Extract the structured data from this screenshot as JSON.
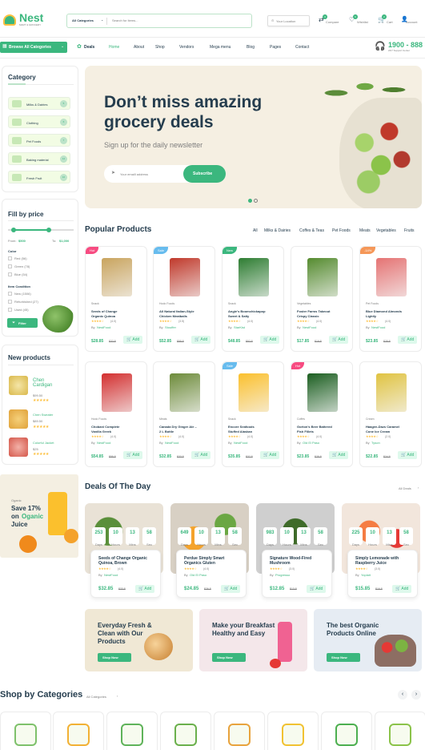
{
  "brand": {
    "name": "Nest",
    "tagline": "MART & GROCERY"
  },
  "search": {
    "category": "All Categories",
    "placeholder": "Search for items..."
  },
  "location": "Your Location",
  "header_actions": [
    {
      "label": "Compare",
      "count": "3"
    },
    {
      "label": "Wishlist",
      "count": "6"
    },
    {
      "label": "Cart",
      "count": "2"
    },
    {
      "label": "Account",
      "count": ""
    }
  ],
  "browse": "Browse All Categories",
  "nav": [
    "Deals",
    "Home",
    "About",
    "Shop",
    "Vendors",
    "Mega menu",
    "Blog",
    "Pages",
    "Contact"
  ],
  "support": {
    "phone": "1900 - 888",
    "sub": "24/7 Support Center"
  },
  "sidebar": {
    "category_title": "Category",
    "categories": [
      {
        "label": "Milks & Dairies",
        "count": "5"
      },
      {
        "label": "Clothing",
        "count": "6"
      },
      {
        "label": "Pet Foods",
        "count": "7"
      },
      {
        "label": "Baking material",
        "count": "12"
      },
      {
        "label": "Fresh Fruit",
        "count": "16"
      }
    ],
    "price_title": "Fill by price",
    "price_from_label": "From:",
    "price_from": "$500",
    "price_to_label": "To:",
    "price_to": "$1,000",
    "color_title": "Color",
    "colors": [
      "Red (56)",
      "Green (78)",
      "Blue (54)"
    ],
    "condition_title": "Item Condition",
    "conditions": [
      "New (1506)",
      "Refurbished (27)",
      "Used (45)"
    ],
    "filter": "Filter",
    "new_title": "New products",
    "new_products": [
      {
        "name": "Chen Cardigan",
        "price": "$99.50"
      },
      {
        "name": "Chen Sweater",
        "price": "$89.50"
      },
      {
        "name": "Colorful Jacket",
        "price": "$25"
      }
    ],
    "promo": {
      "small": "Oganic",
      "line1": "Save 17%",
      "line2": "on",
      "line2b": "Oganic",
      "line3": "Juice"
    }
  },
  "hero": {
    "title1": "Don’t miss amazing",
    "title2": "grocery deals",
    "subtitle": "Sign up for the daily newsletter",
    "email_placeholder": "Your emaill address",
    "button": "Subscribe"
  },
  "popular": {
    "title": "Popular Products",
    "tabs": [
      "All",
      "Milks & Dairies",
      "Coffes & Teas",
      "Pet Foods",
      "Meats",
      "Vegetables",
      "Fruits"
    ],
    "products": [
      {
        "badge": "Hot",
        "cat": "Snack",
        "name1": "Seeds of Change",
        "name2": "Organic Quinoa",
        "rating": "(4.0)",
        "by": "By",
        "vendor": "NestFood",
        "price": "$28.85",
        "old": "$32.8",
        "add": "Add"
      },
      {
        "badge": "Sale",
        "cat": "Hodo Foods",
        "name1": "All Natural Italian-Style",
        "name2": "Chicken Meatballs",
        "rating": "(3.5)",
        "by": "By",
        "vendor": "Stouffer",
        "price": "$52.85",
        "old": "$55.8",
        "add": "Add"
      },
      {
        "badge": "New",
        "cat": "Snack",
        "name1": "Angie’s Boomchickapop",
        "name2": "Sweet & Salty",
        "rating": "(4.0)",
        "by": "By",
        "vendor": "StarKist",
        "price": "$48.85",
        "old": "$52.8",
        "add": "Add"
      },
      {
        "badge": "",
        "cat": "Vegetables",
        "name1": "Foster Farms Takeout",
        "name2": "Crispy Classic",
        "rating": "(4.0)",
        "by": "By",
        "vendor": "NestFood",
        "price": "$17.85",
        "old": "$19.8",
        "add": "Add"
      },
      {
        "badge": "-14%",
        "cat": "Pet Foods",
        "name1": "Blue Diamond Almonds",
        "name2": "Lightly",
        "rating": "(4.0)",
        "by": "By",
        "vendor": "NestFood",
        "price": "$23.85",
        "old": "$25.8",
        "add": "Add"
      },
      {
        "badge": "",
        "cat": "Hodo Foods",
        "name1": "Chobani Complete",
        "name2": "Vanilla Greek",
        "rating": "(4.0)",
        "by": "By",
        "vendor": "NestFood",
        "price": "$54.85",
        "old": "$55.8",
        "add": "Add"
      },
      {
        "badge": "",
        "cat": "Meats",
        "name1": "Canada Dry Ginger Ale –",
        "name2": "2 L Bottle",
        "rating": "(4.0)",
        "by": "By",
        "vendor": "NestFood",
        "price": "$32.85",
        "old": "$33.8",
        "add": "Add"
      },
      {
        "badge": "Sale",
        "cat": "Snack",
        "name1": "Encore Seafoods",
        "name2": "Stuffed Alaskan",
        "rating": "(4.0)",
        "by": "By",
        "vendor": "NestFood",
        "price": "$35.85",
        "old": "$37.8",
        "add": "Add"
      },
      {
        "badge": "Hot",
        "cat": "Coffes",
        "name1": "Gorton’s Beer Battered",
        "name2": "Fish Fillets",
        "rating": "(4.0)",
        "by": "By",
        "vendor": "Old El Paso",
        "price": "$23.85",
        "old": "$25.8",
        "add": "Add"
      },
      {
        "badge": "",
        "cat": "Cream",
        "name1": "Haagen-Dazs Caramel",
        "name2": "Cone Ice Cream",
        "rating": "(2.0)",
        "by": "By",
        "vendor": "Tyson",
        "price": "$22.85",
        "old": "$24.8",
        "add": "Add"
      }
    ]
  },
  "deals": {
    "title": "Deals Of The Day",
    "all": "All Deals",
    "items": [
      {
        "cd": [
          "253",
          "10",
          "13",
          "58"
        ],
        "name1": "Seeds of Change Organic",
        "name2": "Quinoa, Brown",
        "rating": "(4.0)",
        "by": "By",
        "vendor": "NestFood",
        "price": "$32.85",
        "old": "$33.8",
        "add": "Add"
      },
      {
        "cd": [
          "649",
          "10",
          "13",
          "58"
        ],
        "name1": "Perdue Simply Smart",
        "name2": "Organics Gluten",
        "rating": "(4.0)",
        "by": "By",
        "vendor": "Old El Paso",
        "price": "$24.85",
        "old": "$26.8",
        "add": "Add"
      },
      {
        "cd": [
          "983",
          "10",
          "13",
          "58"
        ],
        "name1": "Signature Wood-Fired",
        "name2": "Mushroom",
        "rating": "(3.0)",
        "by": "By",
        "vendor": "Progresso",
        "price": "$12.85",
        "old": "$13.8",
        "add": "Add"
      },
      {
        "cd": [
          "225",
          "10",
          "13",
          "58"
        ],
        "name1": "Simply Lemonade with",
        "name2": "Raspberry Juice",
        "rating": "(3.0)",
        "by": "By",
        "vendor": "Yoplait",
        "price": "$15.85",
        "old": "$16.8",
        "add": "Add"
      }
    ],
    "labels": [
      "Days",
      "Hours",
      "Mins",
      "Sec"
    ]
  },
  "banners": [
    {
      "l1": "Everyday Fresh &",
      "l2": "Clean with Our",
      "l3": "Products",
      "btn": "Shop Now"
    },
    {
      "l1": "Make your Breakfast",
      "l2": "Healthy and Easy",
      "l3": "",
      "btn": "Shop Now"
    },
    {
      "l1": "The best Organic",
      "l2": "Products Online",
      "l3": "",
      "btn": "Shop Now"
    }
  ],
  "shop_cats": {
    "title": "Shop by Categories",
    "all": "All Categories"
  },
  "colors": {
    "brand": "#3bb77e",
    "dark": "#253d4e",
    "hot": "#f74b81",
    "sale": "#67bcee",
    "new": "#3bb77e",
    "off": "#f59758"
  }
}
